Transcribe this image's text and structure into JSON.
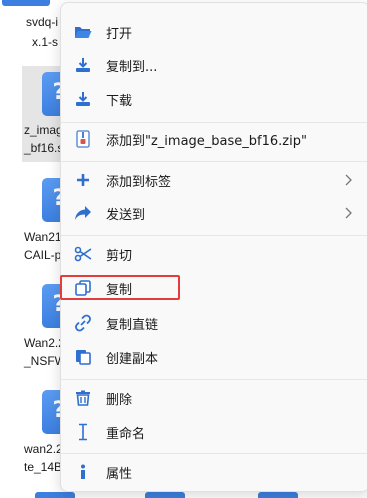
{
  "background_files": [
    {
      "name_line1": "svdq-i",
      "name_line2": "x.1-s"
    },
    {
      "name_line1": "z_imag",
      "name_line2": "_bf16.s"
    },
    {
      "name_line1": "Wan21",
      "name_line2": "CAIL-p"
    },
    {
      "name_line1": "Wan2.2",
      "name_line2": "_NSFW"
    },
    {
      "name_line1": "wan2.2",
      "name_line2": "te_14B"
    }
  ],
  "menu": {
    "items": [
      {
        "label": "打开"
      },
      {
        "label": "复制到..."
      },
      {
        "label": "下载"
      },
      {
        "label": "添加到\"z_image_base_bf16.zip\""
      },
      {
        "label": "添加到标签"
      },
      {
        "label": "发送到"
      },
      {
        "label": "剪切"
      },
      {
        "label": "复制"
      },
      {
        "label": "复制直链"
      },
      {
        "label": "创建副本"
      },
      {
        "label": "删除"
      },
      {
        "label": "重命名"
      },
      {
        "label": "属性"
      }
    ]
  },
  "colors": {
    "accent": "#3d7fe0",
    "highlight": "#e23c3c",
    "menu_bg": "#f9f9f9"
  },
  "icons": [
    "folder-open-icon",
    "copy-to-icon",
    "download-icon",
    "zip-icon",
    "plus-icon",
    "share-icon",
    "scissors-icon",
    "copy-icon",
    "link-icon",
    "duplicate-icon",
    "trash-icon",
    "rename-cursor-icon",
    "info-icon",
    "chevron-right-icon"
  ]
}
